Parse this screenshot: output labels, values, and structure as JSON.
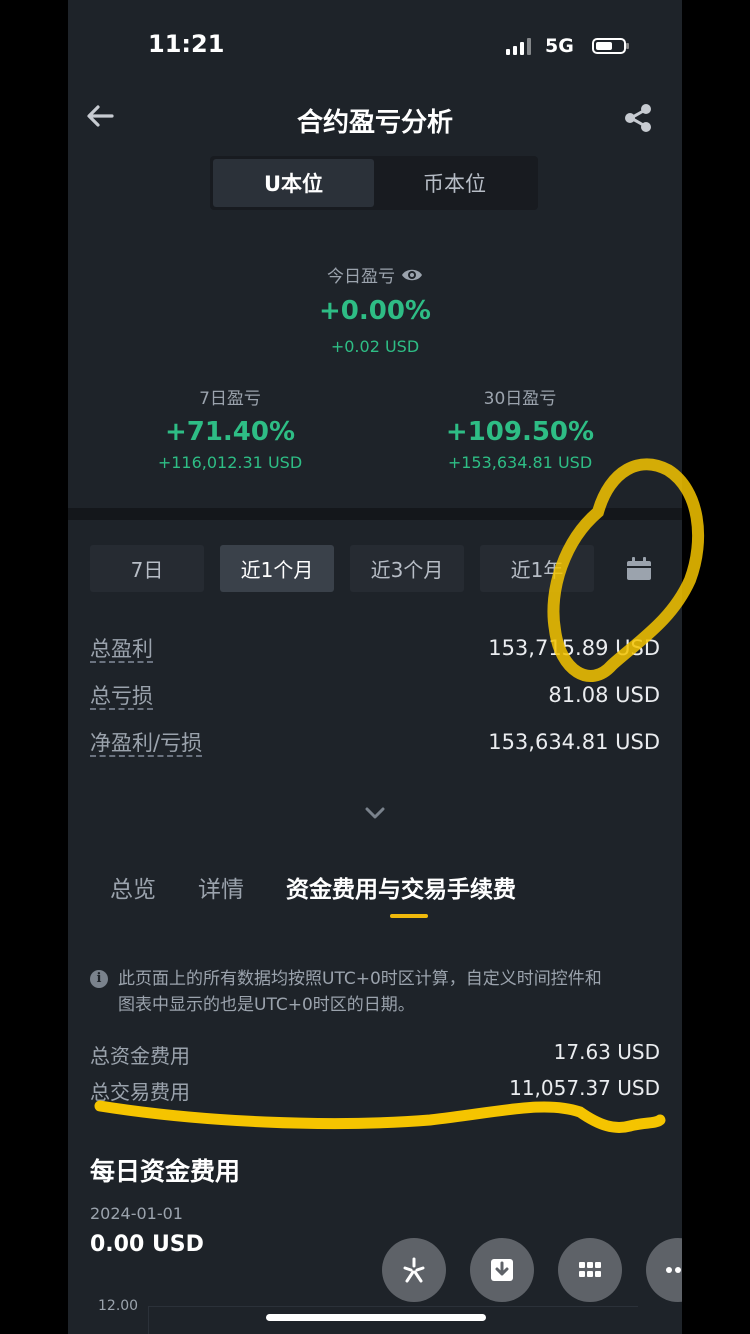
{
  "status_bar": {
    "time": "11:21",
    "network": "5G"
  },
  "header": {
    "title": "合约盈亏分析"
  },
  "segment": {
    "options": [
      "U本位",
      "币本位"
    ],
    "selected": 0
  },
  "summary": {
    "today": {
      "label": "今日盈亏",
      "pct": "+0.00%",
      "usd": "+0.02 USD"
    },
    "d7": {
      "label": "7日盈亏",
      "pct": "+71.40%",
      "usd": "+116,012.31 USD"
    },
    "d30": {
      "label": "30日盈亏",
      "pct": "+109.50%",
      "usd": "+153,634.81 USD"
    }
  },
  "range_tabs": [
    {
      "label": "7日"
    },
    {
      "label": "近1个月"
    },
    {
      "label": "近3个月"
    },
    {
      "label": "近1年"
    }
  ],
  "range_selected": 1,
  "stats": [
    {
      "label": "总盈利",
      "value": "153,715.89 USD"
    },
    {
      "label": "总亏损",
      "value": "81.08 USD"
    },
    {
      "label": "净盈利/亏损",
      "value": "153,634.81 USD"
    }
  ],
  "section_tabs": [
    {
      "label": "总览"
    },
    {
      "label": "详情"
    },
    {
      "label": "资金费用与交易手续费"
    }
  ],
  "section_selected": 2,
  "notice": {
    "line1": "此页面上的所有数据均按照UTC+0时区计算，自定义时间控件和",
    "line2": "图表中显示的也是UTC+0时区的日期。"
  },
  "fees": [
    {
      "label": "总资金费用",
      "value": "17.63 USD"
    },
    {
      "label": "总交易费用",
      "value": "11,057.37 USD"
    }
  ],
  "daily_funding": {
    "title": "每日资金费用",
    "date": "2024-01-01",
    "value": "0.00 USD",
    "y_tick_top": "12.00"
  },
  "colors": {
    "profit_green": "#2ebd85",
    "accent_yellow": "#f0b90b",
    "background": "#1e2329",
    "annotation": "#f5c400"
  },
  "icons": [
    "back-arrow-icon",
    "share-icon",
    "eye-icon",
    "calendar-icon",
    "chevron-down-icon",
    "info-icon",
    "sparkle-icon",
    "download-icon",
    "grid-icon",
    "more-icon"
  ]
}
